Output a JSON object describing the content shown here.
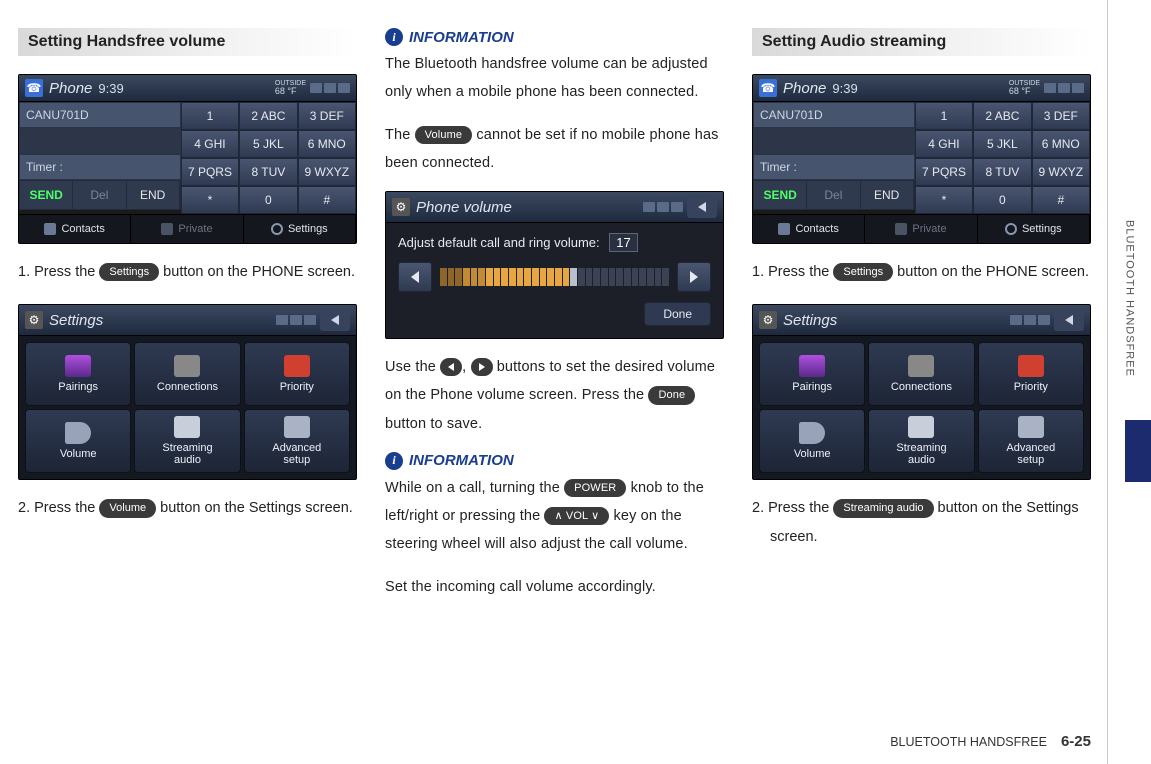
{
  "sideTab": "BLUETOOTH HANDSFREE",
  "footer": {
    "label": "BLUETOOTH HANDSFREE",
    "page": "6-25"
  },
  "col1": {
    "heading": "Setting Handsfree volume",
    "step1_pre": "1. Press the ",
    "step1_btn": "Settings",
    "step1_post": " button on the PHONE screen.",
    "step2_pre": "2. Press the ",
    "step2_btn": "Volume",
    "step2_post": " button on the Settings screen."
  },
  "col2": {
    "infoLabel": "INFORMATION",
    "p1": "The Bluetooth handsfree volume can be adjusted only when a mobile phone has been connected.",
    "p2_pre": "The ",
    "p2_btn": "Volume",
    "p2_post": " cannot be set if no mobile phone has been connected.",
    "p3_pre": "Use the ",
    "p3_mid": ", ",
    "p3_post": " buttons to set the desired volume on the Phone volume screen. Press the ",
    "p3_btn": "Done",
    "p3_end": " button to save.",
    "p4_pre": "While on a call, turning the ",
    "p4_btn1": "POWER",
    "p4_mid": " knob to the left/right or pressing the ",
    "p4_btn2": "∧ VOL ∨",
    "p4_post": " key on the steering wheel will also adjust the call volume.",
    "p5": "Set the incoming call volume accordingly."
  },
  "col3": {
    "heading": "Setting Audio streaming",
    "step1_pre": "1. Press the ",
    "step1_btn": "Settings",
    "step1_post": " button on the PHONE screen.",
    "step2_pre": "2. Press the ",
    "step2_btn": "Streaming audio",
    "step2_post": " button on the Settings screen."
  },
  "device_phone": {
    "title": "Phone",
    "time": "9:39",
    "tempLabel": "OUTSIDE",
    "temp": "68 °F",
    "rowDevice": "CANU701D",
    "rowTimer": "Timer :",
    "send": "SEND",
    "del": "Del",
    "end": "END",
    "keys": [
      "1",
      "2 ABC",
      "3 DEF",
      "4 GHI",
      "5 JKL",
      "6 MNO",
      "7 PQRS",
      "8 TUV",
      "9 WXYZ",
      "*",
      "0",
      "#"
    ],
    "bottom": {
      "contacts": "Contacts",
      "private": "Private",
      "settings": "Settings"
    }
  },
  "device_settings": {
    "title": "Settings",
    "tiles": [
      "Pairings",
      "Connections",
      "Priority",
      "Volume",
      "Streaming\naudio",
      "Advanced\nsetup"
    ]
  },
  "device_volume": {
    "title": "Phone volume",
    "label": "Adjust default call and ring volume:",
    "value": "17",
    "done": "Done"
  }
}
